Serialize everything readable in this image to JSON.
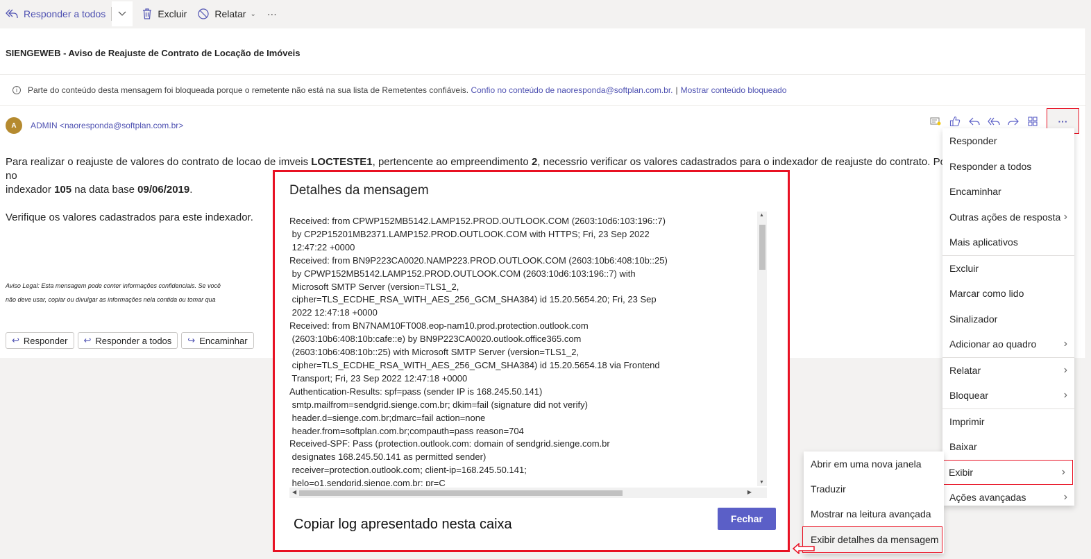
{
  "toolbar": {
    "reply_all": "Responder a todos",
    "delete": "Excluir",
    "report": "Relatar",
    "more": "···"
  },
  "message": {
    "subject": "SIENGEWEB - Aviso de Reajuste de Contrato de Locação de Imóveis",
    "blocked_notice": "Parte do conteúdo desta mensagem foi bloqueada porque o remetente não está na sua lista de Remetentes confiáveis.",
    "trust_link": "Confio no conteúdo de naoresponda@softplan.com.br.",
    "link_separator": "|",
    "show_blocked_link": "Mostrar conteúdo bloqueado",
    "avatar_initial": "A",
    "sender": "ADMIN <naoresponda@softplan.com.br>",
    "more_button": "···",
    "body": {
      "p1_a": "Para realizar o reajuste de valores do contrato de locao de imveis ",
      "p1_b": "LOCTESTE1",
      "p1_c": ", pertencente ao empreendimento ",
      "p1_d": "2",
      "p1_e": ", necessrio verificar os valores cadastrados para o indexador de reajuste do contrato. Pois no",
      "p1_f": "indexador ",
      "p1_g": "105",
      "p1_h": " na data base ",
      "p1_i": "09/06/2019",
      "p1_j": ".",
      "p2": "Verifique os valores cadastrados para este indexador."
    },
    "disclaimer_1": "Aviso Legal: Esta mensagem pode conter informações confidenciais. Se você",
    "disclaimer_2": "não deve usar, copiar ou divulgar as informações nela contida ou tomar qua",
    "reply_buttons": [
      "Responder",
      "Responder a todos",
      "Encaminhar"
    ]
  },
  "dialog": {
    "title": "Detalhes da mensagem",
    "log": "Received: from CPWP152MB5142.LAMP152.PROD.OUTLOOK.COM (2603:10d6:103:196::7)\n by CP2P15201MB2371.LAMP152.PROD.OUTLOOK.COM with HTTPS; Fri, 23 Sep 2022\n 12:47:22 +0000\nReceived: from BN9P223CA0020.NAMP223.PROD.OUTLOOK.COM (2603:10b6:408:10b::25)\n by CPWP152MB5142.LAMP152.PROD.OUTLOOK.COM (2603:10d6:103:196::7) with\n Microsoft SMTP Server (version=TLS1_2,\n cipher=TLS_ECDHE_RSA_WITH_AES_256_GCM_SHA384) id 15.20.5654.20; Fri, 23 Sep\n 2022 12:47:18 +0000\nReceived: from BN7NAM10FT008.eop-nam10.prod.protection.outlook.com\n (2603:10b6:408:10b:cafe::e) by BN9P223CA0020.outlook.office365.com\n (2603:10b6:408:10b::25) with Microsoft SMTP Server (version=TLS1_2,\n cipher=TLS_ECDHE_RSA_WITH_AES_256_GCM_SHA384) id 15.20.5654.18 via Frontend\n Transport; Fri, 23 Sep 2022 12:47:18 +0000\nAuthentication-Results: spf=pass (sender IP is 168.245.50.141)\n smtp.mailfrom=sendgrid.sienge.com.br; dkim=fail (signature did not verify)\n header.d=sienge.com.br;dmarc=fail action=none\n header.from=softplan.com.br;compauth=pass reason=704\nReceived-SPF: Pass (protection.outlook.com: domain of sendgrid.sienge.com.br\n designates 168.245.50.141 as permitted sender)\n receiver=protection.outlook.com; client-ip=168.245.50.141;\n helo=o1.sendgrid.sienge.com.br; pr=C",
    "annotation": "Copiar log apresentado nesta caixa",
    "close_button": "Fechar"
  },
  "context_menu": {
    "items": [
      {
        "label": "Responder"
      },
      {
        "label": "Responder a todos"
      },
      {
        "label": "Encaminhar"
      },
      {
        "label": "Outras ações de resposta"
      },
      {
        "label": "Mais aplicativos"
      },
      {
        "label": "Excluir"
      },
      {
        "label": "Marcar como lido"
      },
      {
        "label": "Sinalizador"
      },
      {
        "label": "Adicionar ao quadro"
      },
      {
        "label": "Relatar"
      },
      {
        "label": "Bloquear"
      },
      {
        "label": "Imprimir"
      },
      {
        "label": "Baixar"
      },
      {
        "label": "Exibir"
      },
      {
        "label": "Ações avançadas"
      }
    ]
  },
  "submenu": {
    "items": [
      {
        "label": "Abrir em uma nova janela"
      },
      {
        "label": "Traduzir"
      },
      {
        "label": "Mostrar na leitura avançada"
      },
      {
        "label": "Exibir detalhes da mensagem"
      }
    ]
  },
  "colors": {
    "accent": "#5b5fc7",
    "link": "#4f52b2",
    "highlight_border": "#e81123"
  }
}
